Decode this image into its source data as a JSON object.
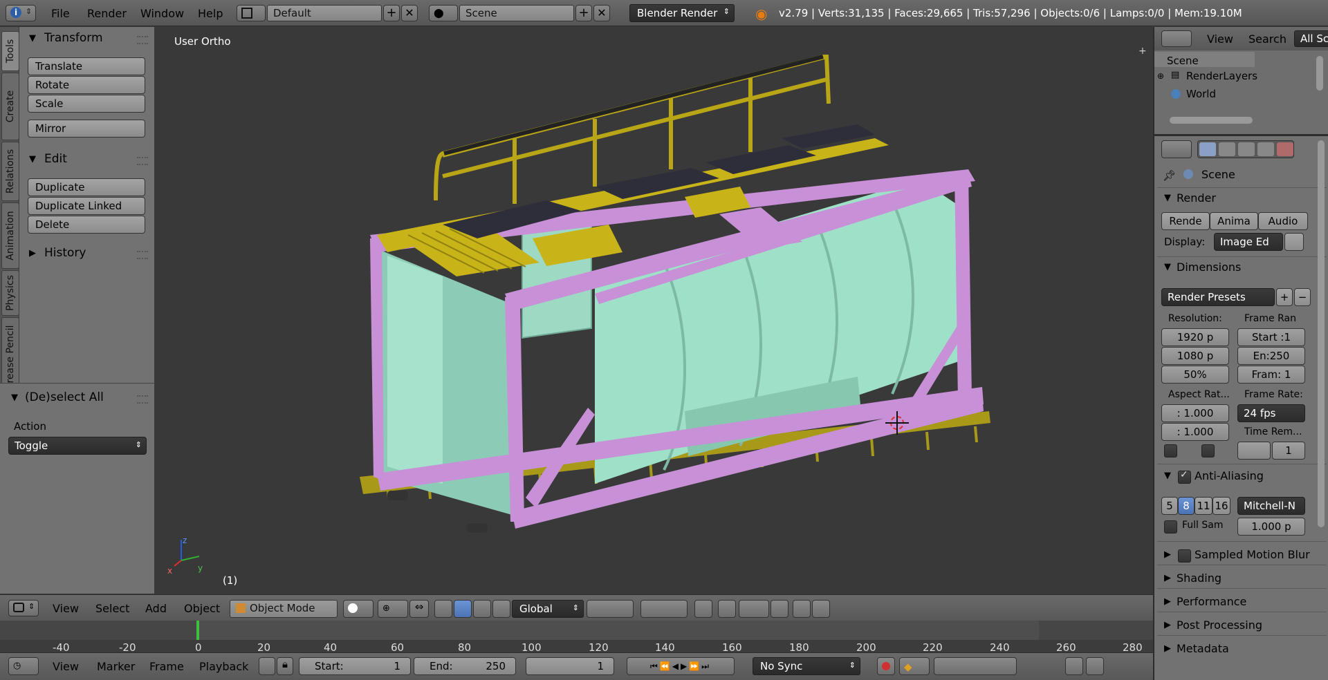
{
  "topbar": {
    "menus": [
      "File",
      "Render",
      "Window",
      "Help"
    ],
    "screen_layout": "Default",
    "scene_name": "Scene",
    "render_engine": "Blender Render",
    "stats": "v2.79 | Verts:31,135 | Faces:29,665 | Tris:57,296 | Objects:0/6 | Lamps:0/0 | Mem:19.10M"
  },
  "tool_tabs": [
    "Tools",
    "Create",
    "Relations",
    "Animation",
    "Physics",
    "Grease Pencil"
  ],
  "toolshelf": {
    "transform_title": "Transform",
    "transform_buttons": [
      "Translate",
      "Rotate",
      "Scale"
    ],
    "mirror": "Mirror",
    "edit_title": "Edit",
    "edit_buttons": [
      "Duplicate",
      "Duplicate Linked",
      "Delete"
    ],
    "history_title": "History",
    "operator_title": "(De)select All",
    "action_label": "Action",
    "action_value": "Toggle"
  },
  "viewport": {
    "view_label": "User Ortho",
    "frame_label": "(1)",
    "axis_x": "x",
    "axis_y": "y",
    "axis_z": "z"
  },
  "view3d_header": {
    "menus": [
      "View",
      "Select",
      "Add",
      "Object"
    ],
    "mode": "Object Mode",
    "orientation": "Global"
  },
  "timeline": {
    "ticks": [
      "-40",
      "-20",
      "0",
      "20",
      "40",
      "60",
      "80",
      "100",
      "120",
      "140",
      "160",
      "180",
      "200",
      "220",
      "240",
      "260",
      "280"
    ],
    "menus": [
      "View",
      "Marker",
      "Frame",
      "Playback"
    ],
    "start_label": "Start:",
    "start_value": "1",
    "end_label": "End:",
    "end_value": "250",
    "current_frame": "1",
    "sync": "No Sync"
  },
  "outliner": {
    "menus": [
      "View",
      "Search"
    ],
    "filter": "All Sc",
    "items": [
      "Scene",
      "RenderLayers",
      "World"
    ]
  },
  "properties": {
    "context": "Scene",
    "render_title": "Render",
    "render_buttons": [
      "Rende",
      "Anima",
      "Audio"
    ],
    "display_label": "Display:",
    "display_value": "Image Ed",
    "dimensions_title": "Dimensions",
    "render_presets": "Render Presets",
    "resolution_label": "Resolution:",
    "res_x": "1920 p",
    "res_y": "1080 p",
    "res_pct": "50%",
    "frame_range_label": "Frame Ran",
    "frame_start": "Start :1",
    "frame_end": "En:250",
    "frame_step": "Fram: 1",
    "aspect_label": "Aspect Rat...",
    "aspect_x": ": 1.000",
    "aspect_y": ": 1.000",
    "frame_rate_label": "Frame Rate:",
    "frame_rate": "24 fps",
    "time_remap_label": "Time Rem...",
    "time_remap_value": "1",
    "aa_title": "Anti-Aliasing",
    "aa_samples": [
      "5",
      "8",
      "11",
      "16"
    ],
    "aa_filter": "Mitchell-N",
    "full_sample": "Full Sam",
    "filter_size": "1.000 p",
    "sampled_motion_blur": "Sampled Motion Blur",
    "shading": "Shading",
    "performance": "Performance",
    "post_processing": "Post Processing",
    "metadata": "Metadata"
  },
  "colors": {
    "frame_purple": "#c890d6",
    "tank_green": "#9fe0c8",
    "walkway_yellow": "#c8b419",
    "active_blue": "#5680c2"
  }
}
